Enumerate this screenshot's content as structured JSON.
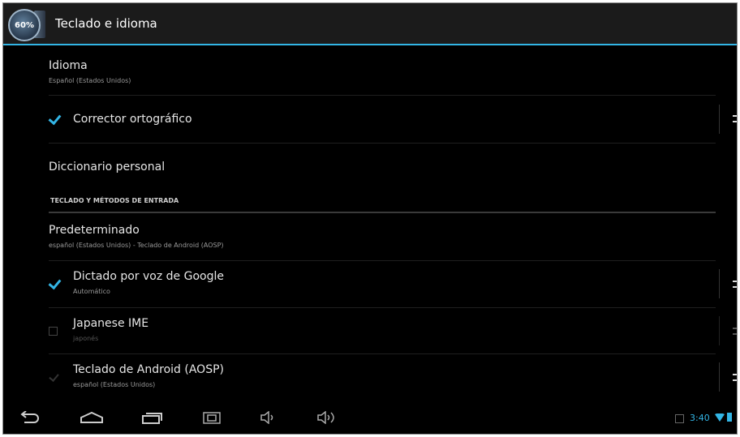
{
  "actionbar": {
    "app_icon_text": "60%",
    "title": "Teclado e idioma"
  },
  "rows": {
    "idioma": {
      "title": "Idioma",
      "summary": "Español (Estados Unidos)"
    },
    "corrector": {
      "title": "Corrector ortográfico",
      "checked": true
    },
    "diccionario": {
      "title": "Diccionario personal"
    },
    "section_header": "TECLADO Y MÉTODOS DE ENTRADA",
    "predeterminado": {
      "title": "Predeterminado",
      "summary": "español (Estados Unidos) - Teclado de Android (AOSP)"
    },
    "dictado": {
      "title": "Dictado por voz de Google",
      "summary": "Automático",
      "checked": true
    },
    "japanese": {
      "title": "Japanese IME",
      "summary": "japonés",
      "checked": false
    },
    "teclado": {
      "title": "Teclado de Android (AOSP)",
      "summary": "español (Estados Unidos)",
      "checked": true
    }
  },
  "status": {
    "time": "3:40"
  },
  "colors": {
    "accent": "#33b5e5",
    "background": "#000000"
  },
  "icons": [
    "back-icon",
    "home-icon",
    "recent-apps-icon",
    "screenshot-icon",
    "volume-down-icon",
    "volume-up-icon",
    "settings-sliders-icon",
    "wifi-icon",
    "battery-icon",
    "notification-icon"
  ]
}
